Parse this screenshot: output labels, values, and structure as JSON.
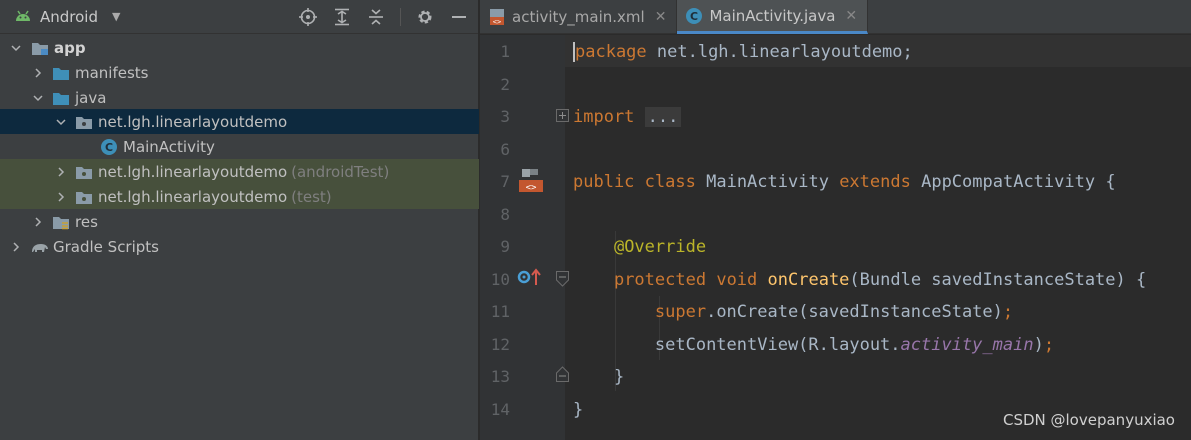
{
  "project_panel": {
    "title": "Android",
    "tree": [
      {
        "label": "app",
        "bold": true,
        "suffix": ""
      },
      {
        "label": "manifests",
        "suffix": ""
      },
      {
        "label": "java",
        "suffix": ""
      },
      {
        "label": "net.lgh.linearlayoutdemo",
        "suffix": ""
      },
      {
        "label": "MainActivity",
        "suffix": ""
      },
      {
        "label": "net.lgh.linearlayoutdemo",
        "suffix": "(androidTest)"
      },
      {
        "label": "net.lgh.linearlayoutdemo",
        "suffix": "(test)"
      },
      {
        "label": "res",
        "suffix": ""
      },
      {
        "label": "Gradle Scripts",
        "suffix": ""
      }
    ]
  },
  "editor": {
    "tabs": [
      {
        "label": "activity_main.xml",
        "active": false
      },
      {
        "label": "MainActivity.java",
        "active": true
      }
    ],
    "line_numbers": [
      "1",
      "2",
      "3",
      "6",
      "7",
      "8",
      "9",
      "10",
      "11",
      "12",
      "13",
      "14"
    ],
    "code": {
      "l1_kw": "package",
      "l1_rest": " net.lgh.linearlayoutdemo;",
      "l3_kw": "import",
      "l3_fold": "...",
      "l7_kw1": "public",
      "l7_kw2": "class",
      "l7_name": "MainActivity",
      "l7_kw3": "extends",
      "l7_rest": "AppCompatActivity {",
      "l9_ann": "@Override",
      "l10_kw1": "protected",
      "l10_kw2": "void",
      "l10_fn": "onCreate",
      "l10_rest": "(Bundle savedInstanceState) {",
      "l11_kw": "super",
      "l11_rest": ".onCreate(savedInstanceState)",
      "l11_semi": ";",
      "l12_a": "setContentView(R.layout.",
      "l12_fld": "activity_main",
      "l12_b": ")",
      "l12_semi": ";",
      "l13": "}",
      "l14": "}"
    }
  },
  "watermark": "CSDN @lovepanyuxiao",
  "colors": {
    "keyword": "#cc7832",
    "annotation": "#bbb529",
    "function": "#ffc66d",
    "field": "#9876aa",
    "text": "#a9b7c6",
    "selection": "#0d293e",
    "test_bg": "#47503c"
  }
}
